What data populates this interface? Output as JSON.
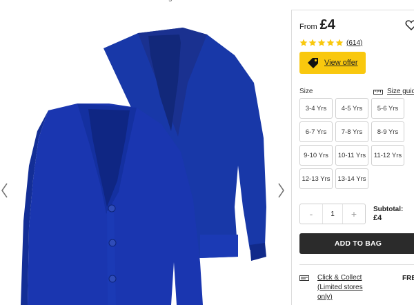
{
  "gallery": {
    "top_fragment": "g",
    "prev_label": "previous",
    "next_label": "next"
  },
  "colors": {
    "cardigan": "#1a36b0",
    "offer": "#f9c80e",
    "star": "#f9c80e",
    "add_to_bag": "#2b2b2b"
  },
  "product": {
    "price_prefix": "From",
    "price": "£4",
    "rating_count": "(614)",
    "stars": 5,
    "offer_label": "View offer"
  },
  "size": {
    "label": "Size",
    "guide_label": "Size guide",
    "options": [
      "3-4 Yrs",
      "4-5 Yrs",
      "5-6 Yrs",
      "6-7 Yrs",
      "7-8 Yrs",
      "8-9 Yrs",
      "9-10 Yrs",
      "10-11 Yrs",
      "11-12 Yrs",
      "12-13 Yrs",
      "13-14 Yrs"
    ]
  },
  "quantity": {
    "minus": "-",
    "value": "1",
    "plus": "+"
  },
  "subtotal": {
    "label": "Subtotal:",
    "value": "£4"
  },
  "actions": {
    "add_to_bag": "ADD TO BAG"
  },
  "delivery": {
    "click_collect": "Click & Collect (Limited stores only)",
    "free": "FREE"
  },
  "icons": [
    "chevron-left-icon",
    "chevron-right-icon",
    "heart-icon",
    "star-icon",
    "price-tag-icon",
    "ruler-icon",
    "store-icon"
  ]
}
